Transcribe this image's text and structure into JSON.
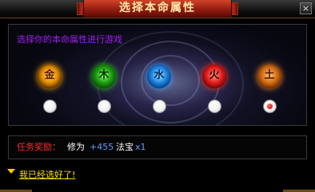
{
  "window": {
    "title": "选择本命属性",
    "close_glyph": "×"
  },
  "game": {
    "instruction": "选择你的本命属性进行游戏",
    "elements": [
      {
        "glyph": "金",
        "icon": "gold-element-orb",
        "color": "#e08a00",
        "selected": false
      },
      {
        "glyph": "木",
        "icon": "wood-element-orb",
        "color": "#1a9a10",
        "selected": false
      },
      {
        "glyph": "水",
        "icon": "water-element-orb",
        "color": "#1a80e0",
        "selected": false
      },
      {
        "glyph": "火",
        "icon": "fire-element-orb",
        "color": "#e01a1a",
        "selected": false
      },
      {
        "glyph": "土",
        "icon": "earth-element-orb",
        "color": "#d06a10",
        "selected": true
      }
    ]
  },
  "reward": {
    "label": "任务奖励：",
    "cultivation_label": "修为",
    "cultivation_value": "+455",
    "treasure_label": "法宝",
    "treasure_value": "x1"
  },
  "footer": {
    "confirm_link": "我已经选好了!"
  },
  "colors": {
    "title_text": "#ffe9a8",
    "instruction": "#a020f0",
    "reward_label": "#ff3030",
    "reward_number": "#5aa0ff",
    "link": "#ffe000"
  }
}
